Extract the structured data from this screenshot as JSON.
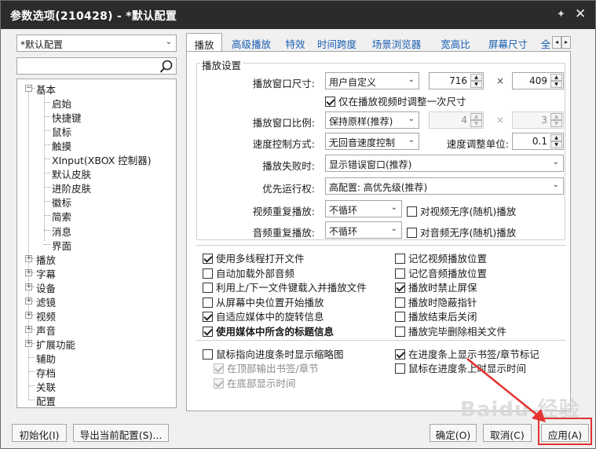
{
  "window": {
    "title": "参数选项(210428) - *默认配置"
  },
  "profile_select": {
    "value": "*默认配置"
  },
  "tree": {
    "items": [
      {
        "label": "基本",
        "expander": "−"
      },
      {
        "label": "启始"
      },
      {
        "label": "快捷键"
      },
      {
        "label": "鼠标"
      },
      {
        "label": "触摸"
      },
      {
        "label": "XInput(XBOX 控制器)"
      },
      {
        "label": "默认皮肤"
      },
      {
        "label": "进阶皮肤"
      },
      {
        "label": "徽标"
      },
      {
        "label": "简索"
      },
      {
        "label": "消息"
      },
      {
        "label": "界面"
      },
      {
        "label": "播放",
        "expander": "+"
      },
      {
        "label": "字幕",
        "expander": "+"
      },
      {
        "label": "设备",
        "expander": "+"
      },
      {
        "label": "滤镜",
        "expander": "+"
      },
      {
        "label": "视频",
        "expander": "+"
      },
      {
        "label": "声音",
        "expander": "+"
      },
      {
        "label": "扩展功能",
        "expander": "+"
      },
      {
        "label": "辅助"
      },
      {
        "label": "存档"
      },
      {
        "label": "关联"
      },
      {
        "label": "配置"
      }
    ]
  },
  "tabs": [
    "播放",
    "高级播放",
    "特效",
    "时间跨度",
    "场景浏览器",
    "宽高比",
    "屏幕尺寸",
    "全"
  ],
  "tab_nav": {
    "prev": "◂",
    "next": "▸"
  },
  "playback": {
    "group_title": "播放设置",
    "window_size": {
      "label": "播放窗口尺寸:",
      "mode": "用户自定义",
      "width": "716",
      "height": "409",
      "times": "×"
    },
    "resize_once": {
      "label": "仅在播放视频时调整一次尺寸",
      "checked": true
    },
    "window_ratio": {
      "label": "播放窗口比例:",
      "mode": "保持原样(推荐)",
      "w": "4",
      "h": "3",
      "times": "×"
    },
    "speed_control": {
      "label": "速度控制方式:",
      "mode": "无回音速度控制"
    },
    "speed_unit": {
      "label": "速度调整单位:",
      "value": "0.1"
    },
    "fail_action": {
      "label": "播放失败时:",
      "value": "显示错误窗口(推荐)"
    },
    "priority": {
      "label": "优先运行权:",
      "value": "高配置: 高优先级(推荐)"
    },
    "video_repeat": {
      "label": "视频重复播放:",
      "value": "不循环",
      "shuffle_label": "对视频无序(随机)播放"
    },
    "audio_repeat": {
      "label": "音频重复播放:",
      "value": "不循环",
      "shuffle_label": "对音频无序(随机)播放"
    }
  },
  "options_left": [
    {
      "label": "使用多线程打开文件",
      "checked": true
    },
    {
      "label": "自动加载外部音频",
      "checked": false
    },
    {
      "label": "利用上/下一文件键载入并播放文件",
      "checked": false
    },
    {
      "label": "从屏幕中央位置开始播放",
      "checked": false
    },
    {
      "label": "自适应媒体中的旋转信息",
      "checked": true
    },
    {
      "label": "使用媒体中所含的标题信息",
      "checked": true
    }
  ],
  "options_right": [
    {
      "label": "记忆视频播放位置",
      "checked": false
    },
    {
      "label": "记忆音频播放位置",
      "checked": false
    },
    {
      "label": "播放时禁止屏保",
      "checked": true
    },
    {
      "label": "播放时隐蔽指针",
      "checked": false
    },
    {
      "label": "播放结束后关闭",
      "checked": false
    },
    {
      "label": "播放完毕删除相关文件",
      "checked": false
    }
  ],
  "progress_options": {
    "thumb": {
      "label": "鼠标指向进度条时显示缩略图",
      "checked": false
    },
    "top_bookmark": {
      "label": "在顶部输出书签/章节",
      "checked": true
    },
    "bottom_time": {
      "label": "在底部显示时间",
      "checked": true
    },
    "bookmark_marks": {
      "label": "在进度条上显示书签/章节标记",
      "checked": true
    },
    "hover_time": {
      "label": "鼠标在进度条上时显示时间",
      "checked": false
    }
  },
  "buttons": {
    "init": "初始化(I)",
    "export": "导出当前配置(S)...",
    "ok": "确定(O)",
    "cancel": "取消(C)",
    "apply": "应用(A)"
  },
  "watermark": "Baidu 经验",
  "colors": {
    "titlebar": "#2b2b2b",
    "highlight": "#e43131",
    "tab_link": "#1a5fb4"
  }
}
